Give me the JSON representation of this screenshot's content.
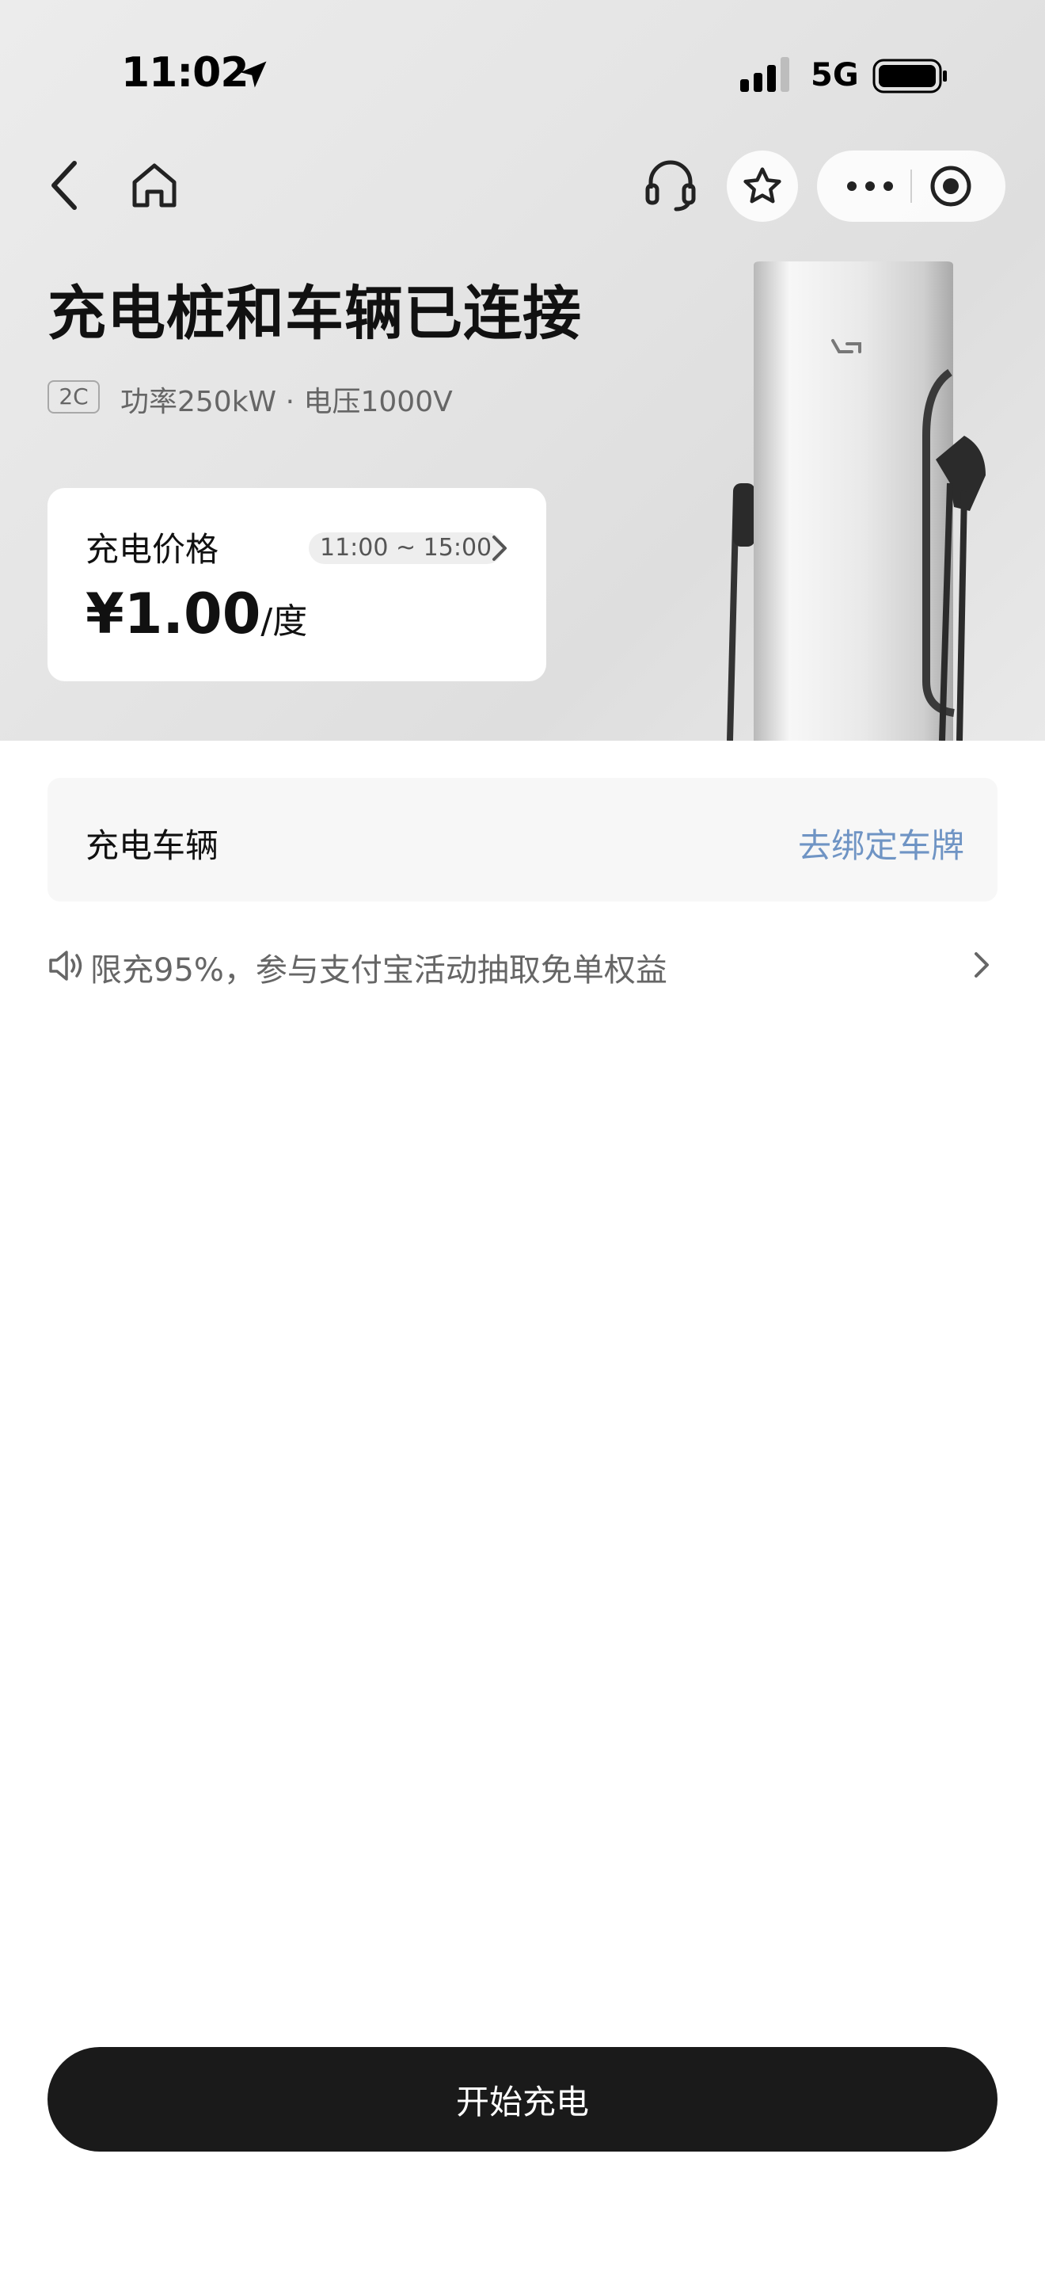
{
  "status_bar": {
    "time": "11:02",
    "network": "5G",
    "icons": [
      "location-arrow-icon",
      "signal-icon",
      "battery-icon"
    ]
  },
  "nav": {
    "icons": [
      "back-icon",
      "home-icon",
      "headset-icon",
      "star-icon",
      "more-icon",
      "close-target-icon"
    ]
  },
  "header": {
    "title": "充电桩和车辆已连接",
    "badge": "2C",
    "spec": "功率250kW · 电压1000V"
  },
  "price": {
    "label": "充电价格",
    "time_range": "11:00 ~ 15:00",
    "value": "¥1.00",
    "unit": "/度"
  },
  "vehicle": {
    "label": "充电车辆",
    "action": "去绑定车牌"
  },
  "notice": {
    "text": "限充95%，参与支付宝活动抽取免单权益"
  },
  "action_button": {
    "label": "开始充电"
  },
  "colors": {
    "primary_button": "#1a1a1a",
    "link": "#6f94c4",
    "hero_bg": "#e5e5e5",
    "card_bg": "#ffffff",
    "row_bg": "#f7f7f7"
  }
}
